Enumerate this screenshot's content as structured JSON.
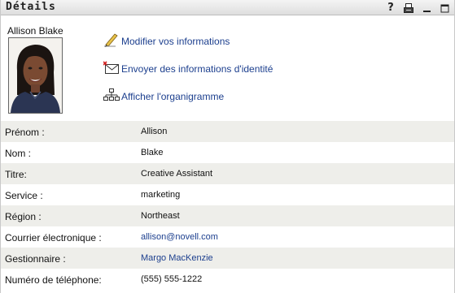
{
  "panel": {
    "title": "Détails",
    "icons": [
      "help-icon",
      "print-icon",
      "minimize-icon",
      "maximize-icon"
    ],
    "help_glyph": "?"
  },
  "user": {
    "name": "Allison Blake"
  },
  "actions": [
    {
      "label": "Modifier vos informations",
      "icon": "pencil-icon"
    },
    {
      "label": "Envoyer des informations d'identité",
      "icon": "envelope-icon"
    },
    {
      "label": "Afficher l'organigramme",
      "icon": "org-chart-icon"
    }
  ],
  "details": [
    {
      "label": "Prénom :",
      "value": "Allison",
      "link": false
    },
    {
      "label": "Nom :",
      "value": "Blake",
      "link": false
    },
    {
      "label": "Titre:",
      "value": "Creative Assistant",
      "link": false
    },
    {
      "label": "Service :",
      "value": "marketing",
      "link": false
    },
    {
      "label": "Région :",
      "value": "Northeast",
      "link": false
    },
    {
      "label": "Courrier électronique :",
      "value": "allison@novell.com",
      "link": true
    },
    {
      "label": "Gestionnaire :",
      "value": "Margo MacKenzie",
      "link": true
    },
    {
      "label": "Numéro de téléphone:",
      "value": "(555) 555-1222",
      "link": false
    }
  ],
  "colors": {
    "link": "#1c3f8e",
    "row_alt": "#eeeeea",
    "titlebar": "#e6e6e6"
  }
}
